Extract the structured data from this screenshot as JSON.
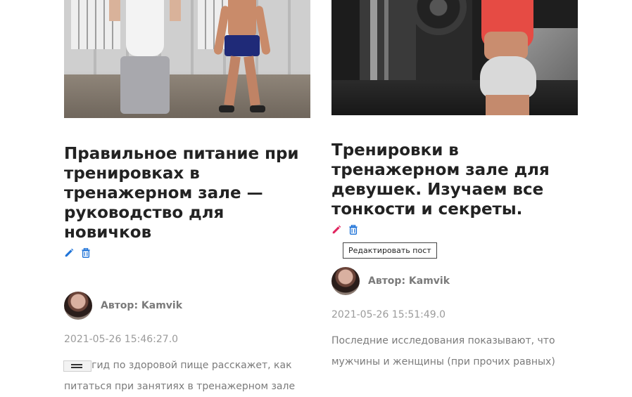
{
  "posts": [
    {
      "title": "Правильное питание при тренировках в тренажерном зале — руководство для новичков",
      "author_label": "Автор: Kamvik",
      "date": "2021-05-26 15:46:27.0",
      "excerpt": "Этот гид по здоровой пище расскажет, как питаться при занятиях в тренажерном зале"
    },
    {
      "title": "Тренировки в тренажерном зале для девушек. Изучаем все тонкости и секреты.",
      "author_label": "Автор: Kamvik",
      "date": "2021-05-26 15:51:49.0",
      "excerpt": "Последние исследования показывают, что мужчины и женщины (при прочих равных)"
    }
  ],
  "tooltip": "Редактировать пост",
  "colors": {
    "edit_icon_default": "#1e73d8",
    "edit_icon_hover": "#e0245e",
    "delete_icon": "#1e73d8"
  },
  "icons": {
    "edit": "pencil-icon",
    "delete": "trash-icon",
    "menu": "hamburger-icon"
  }
}
